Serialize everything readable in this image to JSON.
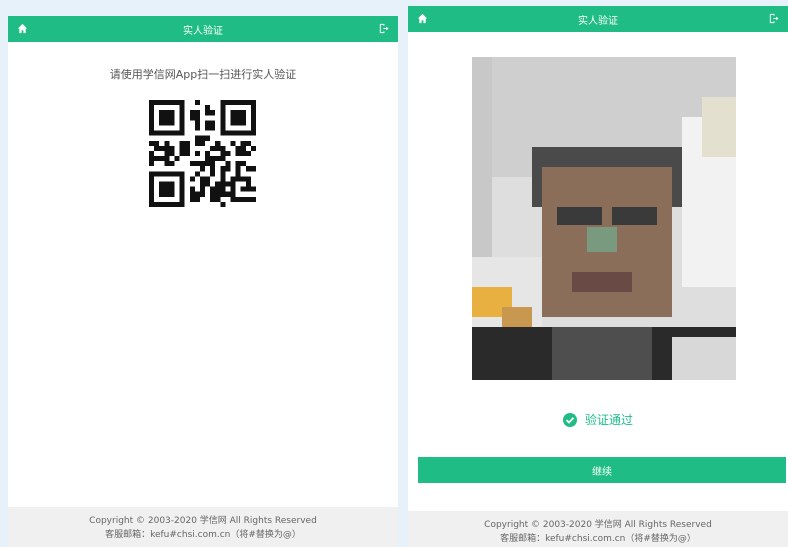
{
  "left": {
    "header_title": "实人验证",
    "instruction": "请使用学信网App扫一扫进行实人验证",
    "footer_copyright": "Copyright © 2003-2020 学信网 All Rights Reserved",
    "footer_contact": "客服邮箱：kefu#chsi.com.cn（将#替换为@）"
  },
  "right": {
    "header_title": "实人验证",
    "status_text": "验证通过",
    "continue_label": "继续",
    "footer_copyright": "Copyright © 2003-2020 学信网 All Rights Reserved",
    "footer_contact": "客服邮箱：kefu#chsi.com.cn（将#替换为@）"
  },
  "colors": {
    "brand": "#1fbd85",
    "footer_bg": "#f0f0f0"
  },
  "icons": [
    "home-icon",
    "exit-icon",
    "check-circle-icon"
  ]
}
